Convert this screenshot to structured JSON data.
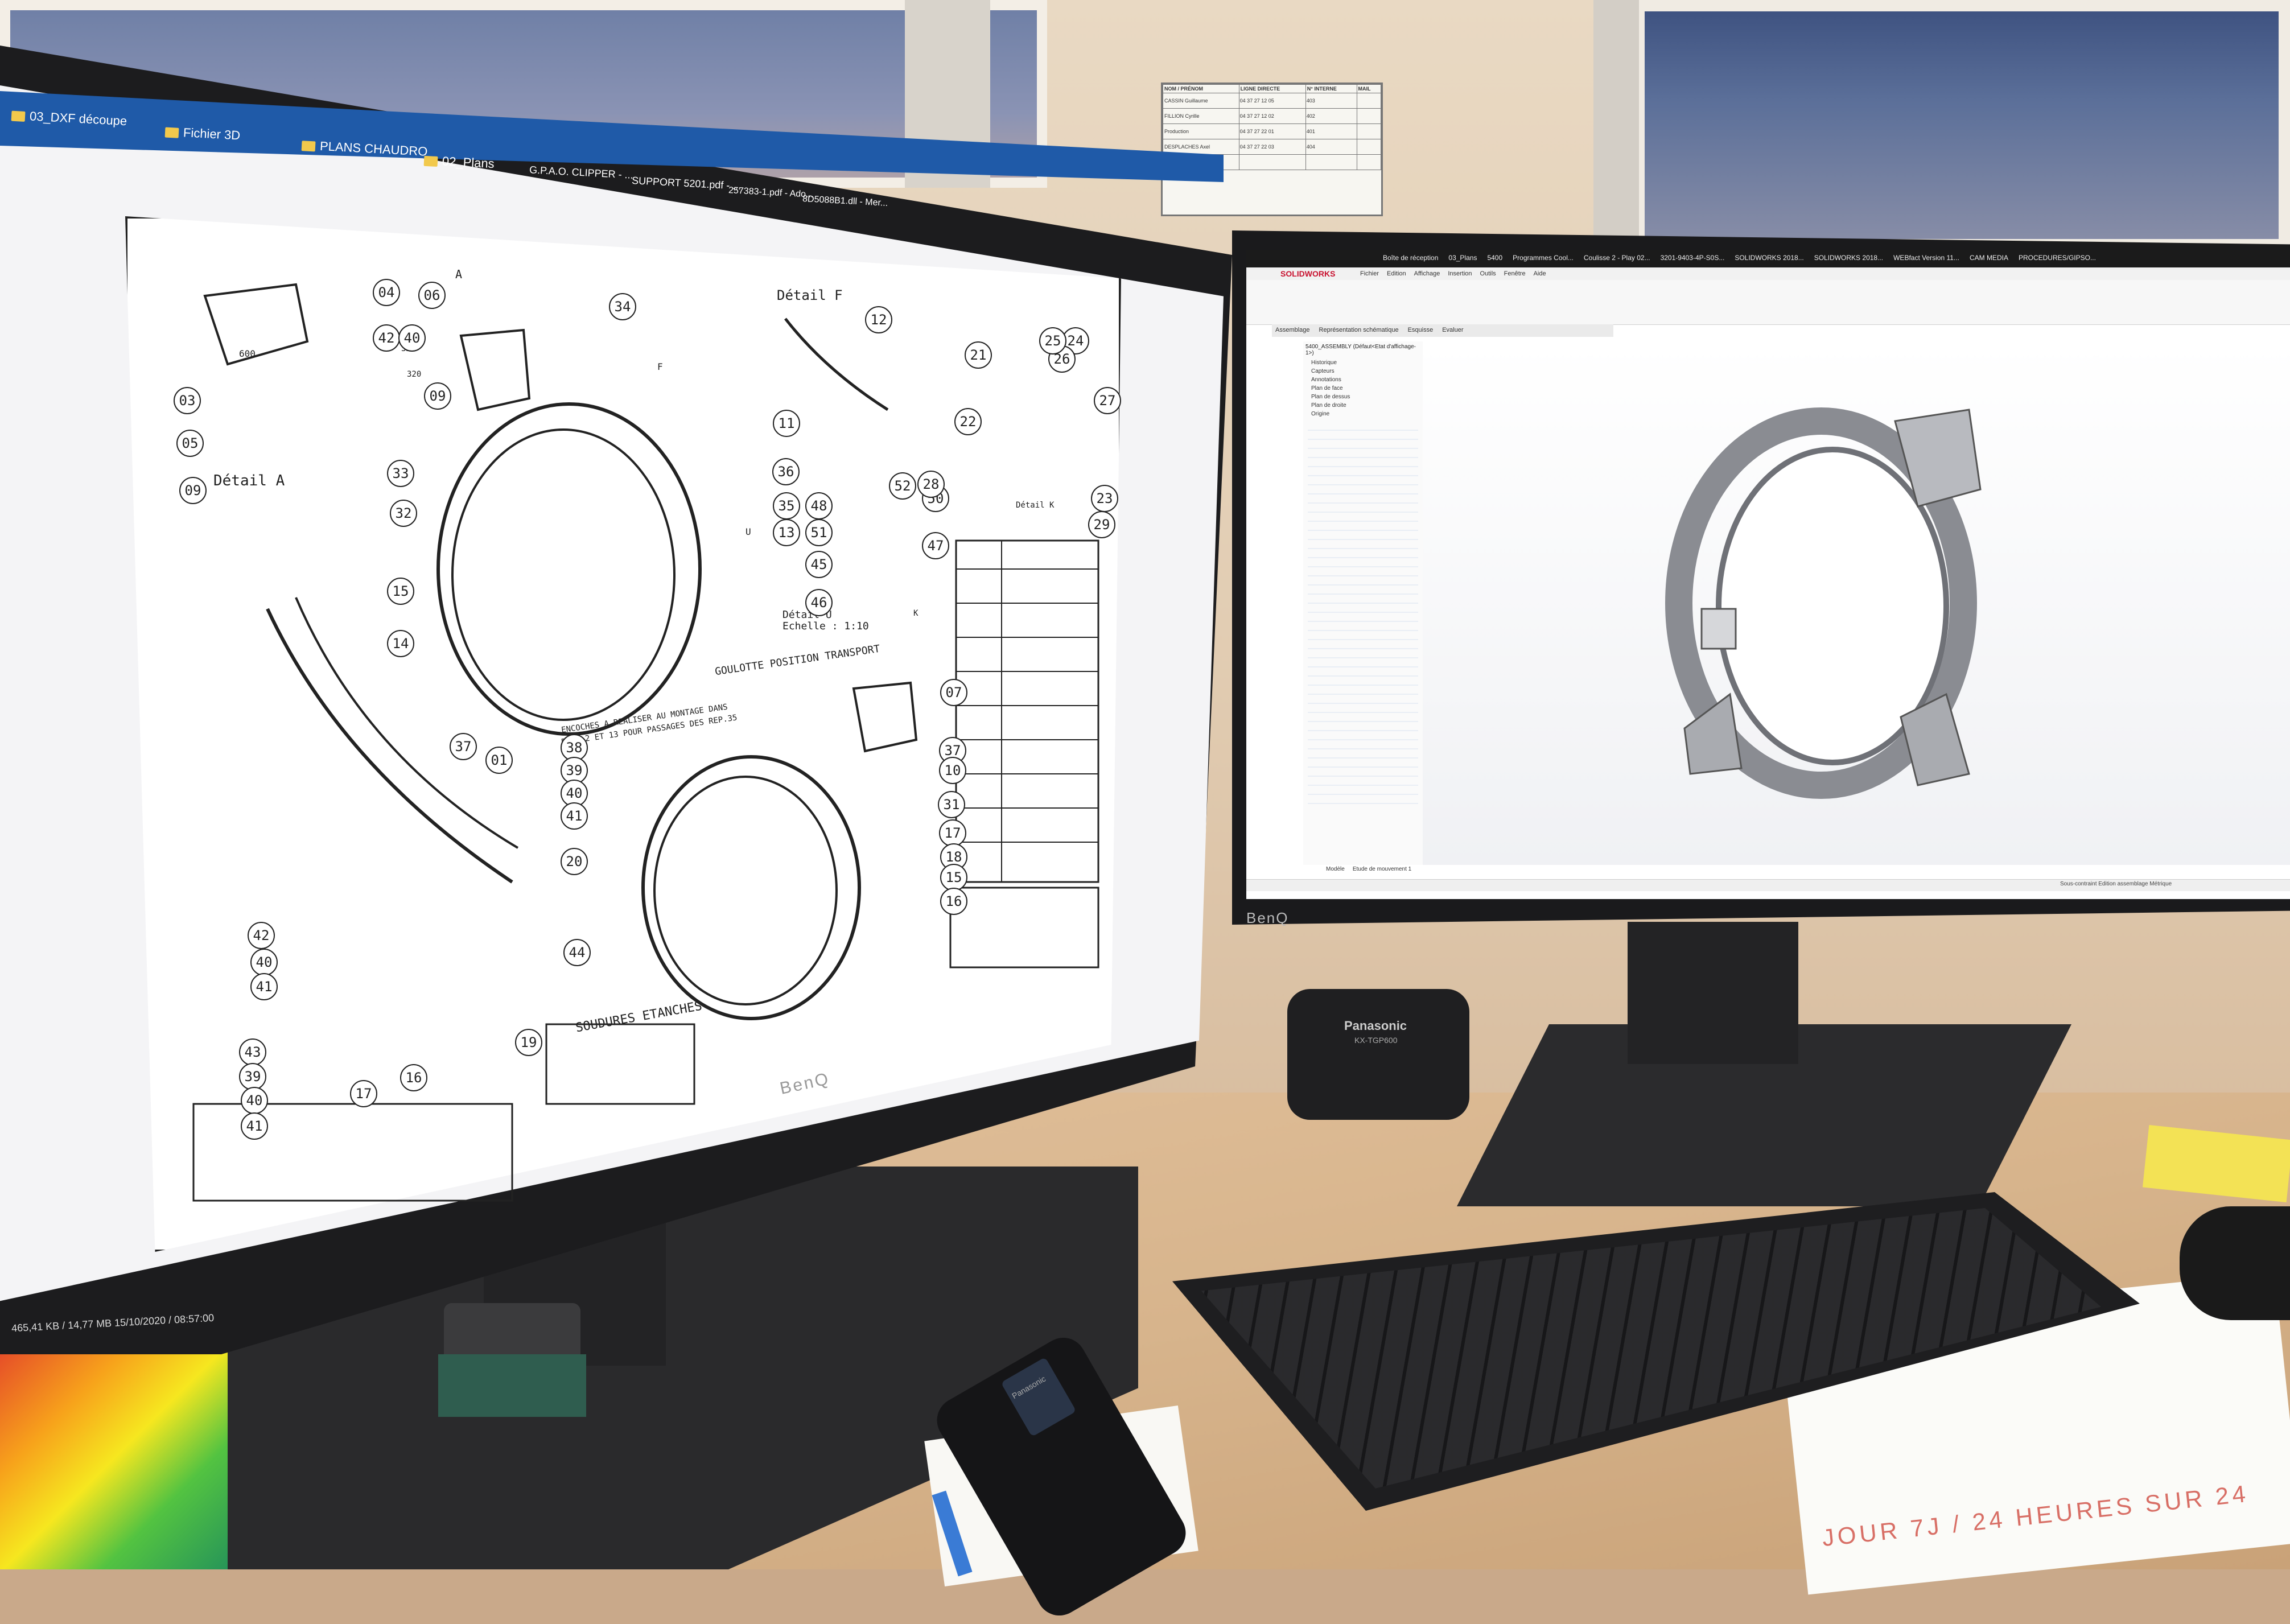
{
  "left_monitor": {
    "brand": "BenQ",
    "taskbar_items": [
      {
        "label": "03_DXF découpe",
        "icon": "folder-icon"
      },
      {
        "label": "Fichier 3D",
        "icon": "folder-icon"
      },
      {
        "label": "PLANS CHAUDRO",
        "icon": "folder-icon"
      },
      {
        "label": "02_Plans",
        "icon": "folder-icon"
      },
      {
        "label": "G.P.A.O. CLIPPER - ...",
        "icon": "app-icon"
      },
      {
        "label": "SUPPORT 5201.pdf - ...",
        "icon": "pdf-icon"
      },
      {
        "label": "257383-1.pdf - Ado...",
        "icon": "pdf-icon"
      },
      {
        "label": "8D5088B1.dll - Mer...",
        "icon": "pdf-icon"
      }
    ],
    "drawing": {
      "labels": {
        "detail_a": "Détail A",
        "detail_f": "Détail F",
        "detail_k": "Détail K",
        "detail_u": "Détail U",
        "echelle": "Echelle : 1:10",
        "goulotte": "GOULOTTE POSITION TRANSPORT",
        "encoches": "ENCOCHES A REALISER AU MONTAGE DANS",
        "encoches2": "REP. 2 ET 13 POUR PASSAGES DES REP.35",
        "soudures": "SOUDURES ETANCHES",
        "a": "A",
        "f": "F",
        "u": "U",
        "k": "K",
        "dim600": "600",
        "dim320a": "320",
        "dim320b": "320"
      },
      "balloons": [
        "04",
        "06",
        "34",
        "42",
        "40",
        "03",
        "09",
        "05",
        "09",
        "33",
        "32",
        "15",
        "14",
        "37",
        "01",
        "38",
        "39",
        "40",
        "41",
        "20",
        "42",
        "40",
        "41",
        "44",
        "43",
        "39",
        "40",
        "41",
        "17",
        "16",
        "19",
        "12",
        "11",
        "36",
        "35",
        "13",
        "45",
        "46",
        "48",
        "51",
        "52",
        "50",
        "47",
        "21",
        "22",
        "28",
        "24",
        "26",
        "27",
        "23",
        "29",
        "07",
        "37",
        "10",
        "31",
        "17",
        "18",
        "15",
        "16",
        "25"
      ]
    },
    "status_bar": "465,41 KB / 14,77 MB  15/10/2020 / 08:57:00"
  },
  "right_monitor": {
    "brand": "BenQ",
    "app": "SOLIDWORKS",
    "taskbar_items": [
      "Boîte de réception",
      "03_Plans",
      "5400",
      "Programmes Cool...",
      "Coulisse 2 - Play 02...",
      "3201-9403-4P-S0S...",
      "SOLIDWORKS 2018...",
      "SOLIDWORKS 2018...",
      "WEBfact Version 11...",
      "CAM MEDIA",
      "PROCEDURES/GIPSO..."
    ],
    "menu_items": [
      "Fichier",
      "Edition",
      "Affichage",
      "Insertion",
      "Outils",
      "Fenêtre",
      "Aide"
    ],
    "ribbon_tabs": [
      "Assemblage",
      "Représentation schématique",
      "Esquisse",
      "Evaluer"
    ],
    "tree_root": "5400_ASSEMBLY (Défaut<Etat d'affichage-1>)",
    "tree_items": [
      "Historique",
      "Capteurs",
      "Annotations",
      "Plan de face",
      "Plan de dessus",
      "Plan de droite",
      "Origine"
    ],
    "bottom_tabs": [
      "Modèle",
      "Etude de mouvement 1"
    ],
    "status_text": "Sous-contraint  Edition assemblage  Métrique"
  },
  "router": {
    "brand": "Panasonic",
    "model": "KX-TGP600"
  },
  "phone": {
    "brand": "Panasonic"
  },
  "notice_board": {
    "headers": [
      "NOM / PRÉNOM",
      "LIGNE DIRECTE",
      "N° INTERNE",
      "MAIL"
    ],
    "rows": [
      [
        "CASSIN Guillaume",
        "04 37 27 12 05",
        "403",
        ""
      ],
      [
        "FILLION Cyrille",
        "04 37 27 12 02",
        "402",
        ""
      ],
      [
        "Production",
        "04 37 27 22 01",
        "401",
        ""
      ],
      [
        "DESPLACHES Axel",
        "04 37 27 22 03",
        "404",
        ""
      ],
      [
        "Qualité",
        "",
        "",
        ""
      ]
    ]
  },
  "paper_text": "JOUR 7J / 24 HEURES SUR 24",
  "colors": {
    "taskbar_blue": "#1f5aa8",
    "solidworks_red": "#c8102e",
    "drawing_line": "#222222"
  }
}
